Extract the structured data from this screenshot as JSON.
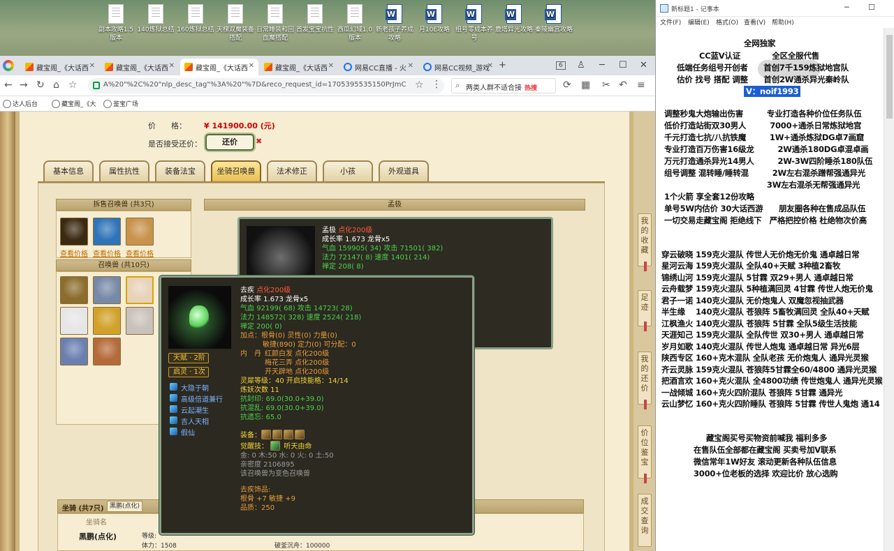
{
  "desktop": {
    "icons": [
      {
        "label": "副本攻略1.5版本",
        "type": "file"
      },
      {
        "label": "140炼狱总结",
        "type": "file"
      },
      {
        "label": "160炼狱总结",
        "type": "file"
      },
      {
        "label": "天梯双魔装备搭配",
        "type": "file"
      },
      {
        "label": "日常睡装和回血魔搭配",
        "type": "file"
      },
      {
        "label": "首发宝宝抗性",
        "type": "file"
      },
      {
        "label": "西瓜幻域1.0版本",
        "type": "file"
      },
      {
        "label": "新老孩子养成攻略",
        "type": "word"
      },
      {
        "label": "月10E攻略",
        "type": "word"
      },
      {
        "label": "组号零成本养号",
        "type": "word"
      },
      {
        "label": "鹿塔异光攻略",
        "type": "word"
      },
      {
        "label": "秦陵幽宫攻略",
        "type": "word"
      }
    ]
  },
  "browser": {
    "tabs": [
      {
        "label": "藏宝阁_《大话西",
        "icon": "cbg"
      },
      {
        "label": "藏宝阁_《大话西",
        "icon": "cbg"
      },
      {
        "label": "藏宝阁_《大话西",
        "icon": "cbg",
        "active": true
      },
      {
        "label": "藏宝阁_《大话西",
        "icon": "cbg"
      },
      {
        "label": "网易CC直播 - 火",
        "icon": "cc"
      },
      {
        "label": "网易CC视频_游戏",
        "icon": "cc"
      }
    ],
    "tab_count": "6",
    "url": "A%20\"%2C%20\"nlp_desc_tag\"%3A%20\"%7D&reco_request_id=1705395535150PrJmC",
    "search_text": "两类人群不适合接",
    "search_hot": "热搜",
    "bookmarks": [
      "达人后台",
      "藏宝阁_《大",
      "鉴宝广场"
    ]
  },
  "listing": {
    "price_label": "价　　格：",
    "price_value": "¥ 141900.00 (元)",
    "counter_label": "是否接受还价：",
    "counter_button": "还价",
    "tabs": [
      "基本信息",
      "属性抗性",
      "装备法宝",
      "坐骑召唤兽",
      "法术修正",
      "小孩",
      "外观道具"
    ],
    "active_tab": "坐骑召唤兽",
    "sold_beasts_title": "拆售召唤兽 (共3只)",
    "view_price": "查看价格",
    "summons_title": "召唤兽 (共10只)",
    "mounts_title": "坐骑 (共7只)",
    "mounts_tab": "黑鹏(点化)",
    "mount_col": "坐骑名",
    "mount_name": "黑鹏(点化)",
    "mount_level_label": "等级:",
    "mount_hp_label": "体力：1508",
    "mount_break": "破釜沉舟：100000"
  },
  "panel_top": {
    "header": "孟极",
    "name": "孟极",
    "tag": "点化200级",
    "growth": "成长率 1.673 龙骨x5",
    "line1_a": "气血",
    "line1_b": "159905( 34)",
    "line1_c": "攻击",
    "line1_d": "71501( 382)",
    "line2_a": "法力",
    "line2_b": "72147( 8)",
    "line2_c": "速度",
    "line2_d": "1401( 214)",
    "line3": "禅定 208( 8)"
  },
  "popup": {
    "name": "去疾",
    "tag": "点化200级",
    "growth": "成长率 1.673 龙骨x5",
    "hp": "92199( 68)",
    "atk": "14723( 28)",
    "mp": "148572( 328)",
    "spd": "2524( 218)",
    "zen": "禅定 200( 0)",
    "add": "加点：根骨(0) 灵性(0) 力量(0)",
    "add2": "敏捷(890) 定力(0) 可分配：0",
    "dan_label": "内　丹",
    "dan1": "红颜白发 点化200级",
    "dan2": "梅花三弄 点化200级",
    "dan3": "开天辟地 点化200级",
    "spirit": "灵犀等级：40 开启技能格：14/14",
    "refine": "炼妖次数 11",
    "res1": "抗封印: 69.0(30.0+39.0)",
    "res2": "抗混乱: 69.0(30.0+39.0)",
    "res3": "抗遗忘: 65.0",
    "equip_label": "装备：",
    "awake_label": "觉醒技：",
    "awake_skill": "听天由命",
    "elements": "金: 0 木:50 水: 0 火: 0 土:50",
    "intimacy": "亲密度 2106895",
    "change": "该召唤兽为变色召唤兽",
    "orn_title": "去疾饰品:",
    "orn1": "根骨 +7 敏捷 +9",
    "orn2": "品质：250",
    "talent": "天赋 · 2阶",
    "spirit_badge": "启灵 · 1次",
    "skills": [
      "大隐于朝",
      "高级倍道兼行",
      "云起潮生",
      "吉人天相",
      "假仙"
    ]
  },
  "side_tabs": [
    "我的收藏",
    "足迹",
    "我的还价",
    "价位鉴宝",
    "成交查询"
  ],
  "notepad": {
    "title": "新标题1 - 记事本",
    "menu": [
      "文件(F)",
      "编辑(E)",
      "格式(O)",
      "查看(V)",
      "帮助(H)"
    ],
    "lines": [
      "全网独家",
      "CC蓝V认证　　　　全区全服代售",
      "低端任务组号开创者　　首创7千159炼狱地宫队",
      "估价 找号 搭配 调整　　首创2W通杀异光秦岭队",
      "V：noif1993",
      "调整秒鬼大炮输出伤害　　　专业打造各种价位任务队伍",
      "低价打造站街双30男人　　　7000+通杀日常炼狱地宫",
      "千元打造七抗/八抗铁魔　　　1W+通杀炼狱DG卓7画窟",
      "专业打造百万伤害16级龙　　　2W通杀180DG卓混卓画",
      "万元打造通杀异光14男人　　　2W-3W四阶睡杀180队伍",
      "组号调整 混转睡/睡转混　　　2W左右混杀蹭帮强通异光",
      "　　　　　　　　　　　　　3W左右混杀无帮强通异光",
      "1个火箭 享全套12份攻略",
      "单号5W内估价 30大话西游　　朋友圈各种在售成品队伍",
      "一切交易走藏宝阁 拒绝线下　严格把控价格 杜绝物次价高",
      "穿云破晓 159克火混队 传世人无价炮无价鬼 通卓越日常",
      "星河云海 159克火混队 全队40+天赋 3种植2畜牧",
      "锦绣山河 159克火混队 5甘霖 双29+男人 通卓越日常",
      "云舟载梦 159克火混队 5种植满回灵 4甘霖 传世人炮无价鬼",
      "君子一诺 140克火混队 无价炮鬼人 双魔忽视抽武器",
      "半生缘　 140克火混队 苍狼阵 5畜牧满回灵 全队40+天赋",
      "江枫渔火 140克火混队 苍狼阵 5甘霖 全队5级生活技能",
      "天涯知己 159克火混队 全队传世 双30+男人 通卓越日常",
      "岁月如歌 140克火混队 传世人炮鬼 通卓越日常 异光6层",
      "陕西专区 160+克木混队 全队老孩 无价炮鬼人 通异光灵猴",
      "齐云灵脉 159克火混队 苍狼阵5甘霖全60/4800 通异光灵猴",
      "把酒言欢 160+克火混队 全4800功绩 传世炮鬼人 通异光灵猴",
      "一战倾城 160+克火四阶混队 苍狼阵 5甘霖 通异光",
      "云山梦忆 160+克火四阶睡队 苍狼阵 5甘霖 传世人鬼炮 通14",
      "藏宝阁买号买物资前喊我 福利多多",
      "在售队伍全部都在藏宝阁 买卖号加V联系",
      "微信常年1W好友 滚动更新各种队伍信息",
      "3000+位老板的选择 欢迎比价 放心选购"
    ]
  }
}
